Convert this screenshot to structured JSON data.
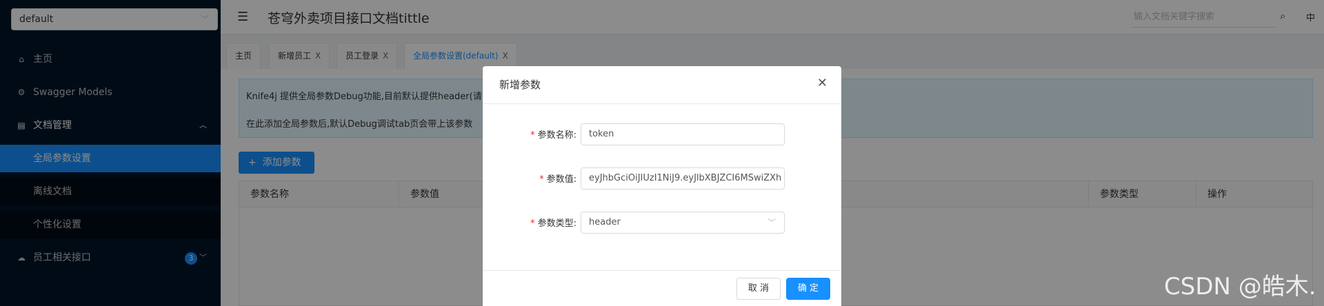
{
  "sidebar": {
    "group_select": "default",
    "items": [
      {
        "label": "主页"
      },
      {
        "label": "Swagger Models"
      },
      {
        "label": "文档管理"
      },
      {
        "label": "全局参数设置"
      },
      {
        "label": "离线文档"
      },
      {
        "label": "个性化设置"
      },
      {
        "label": "员工相关接口",
        "badge": "3"
      }
    ]
  },
  "header": {
    "title": "苍穹外卖项目接口文档tittle",
    "search_placeholder": "输入文档关键字搜索",
    "lang": "中"
  },
  "tabs": [
    {
      "label": "主页"
    },
    {
      "label": "新增员工"
    },
    {
      "label": "员工登录"
    },
    {
      "label": "全局参数设置(default)"
    }
  ],
  "tab_close": "X",
  "content": {
    "alert_line1": "Knife4j 提供全局参数Debug功能,目前默认提供header(请",
    "alert_line2": "在此添加全局参数后,默认Debug调试tab页会带上该参数",
    "add_button": "添加参数",
    "columns": [
      "参数名称",
      "参数值",
      "参数类型",
      "操作"
    ]
  },
  "modal": {
    "title": "新增参数",
    "fields": [
      {
        "label": "参数名称:",
        "value": "token"
      },
      {
        "label": "参数值:",
        "value": "eyJhbGciOiJIUzI1NiJ9.eyJlbXBJZCI6MSwiZXh"
      },
      {
        "label": "参数类型:",
        "value": "header"
      }
    ],
    "cancel": "取 消",
    "ok": "确 定"
  },
  "watermark": "CSDN @皓木."
}
